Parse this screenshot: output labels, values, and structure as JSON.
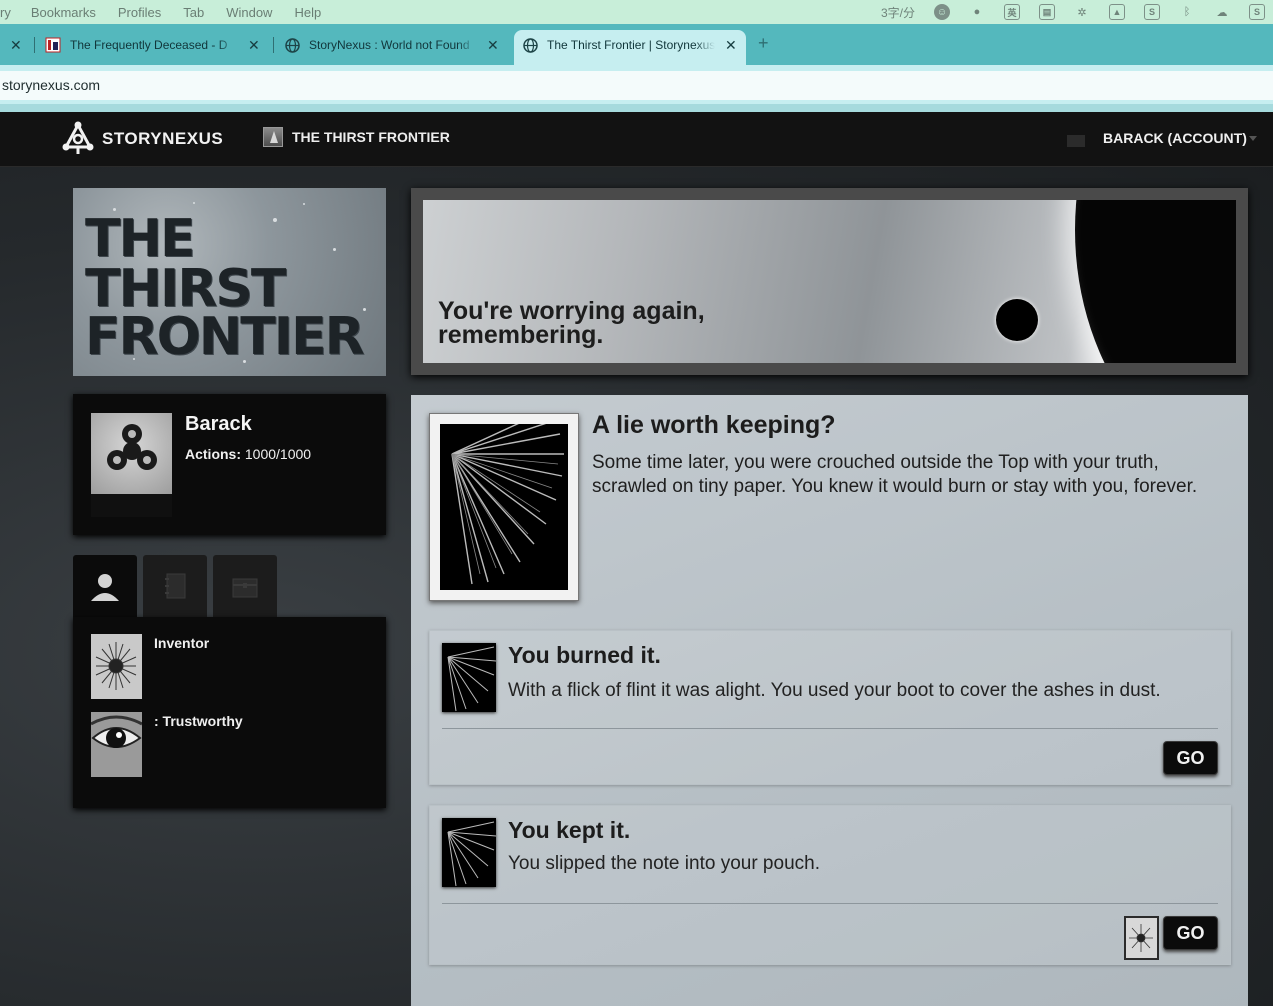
{
  "menubar": {
    "items": [
      "ry",
      "Bookmarks",
      "Profiles",
      "Tab",
      "Window",
      "Help"
    ],
    "input_rate": "3字/分",
    "ime_label": "英"
  },
  "browser": {
    "tabs": [
      {
        "title": "The Frequently Deceased - D",
        "active": false
      },
      {
        "title": "StoryNexus : World not Found",
        "active": false
      },
      {
        "title": "The Thirst Frontier | Storynexus",
        "active": true
      }
    ],
    "address": "storynexus.com",
    "new_tab": "+"
  },
  "site": {
    "brand": "STORYNEXUS",
    "game_title": "THE THIRST FRONTIER",
    "account": "BARACK (ACCOUNT)"
  },
  "banner": {
    "lines": [
      "THE",
      "THIRST",
      "FRONTIER"
    ]
  },
  "character": {
    "name": "Barack",
    "actions_label": "Actions:",
    "actions_value": "1000/1000"
  },
  "qualities": [
    {
      "name": "Inventor",
      "icon": "star-sigil-icon"
    },
    {
      "name": ": Trustworthy",
      "icon": "eye-icon"
    }
  ],
  "storylet_header": {
    "title": "You're worrying again, remembering."
  },
  "storylet": {
    "title": "A lie worth keeping?",
    "description": "Some time later, you were crouched outside the Top with your truth, scrawled on tiny paper. You knew it would burn or stay with you, forever."
  },
  "branches": [
    {
      "title": "You burned it.",
      "description": "With a flick of flint it was alight. You used your boot to cover the ashes in dust.",
      "button": "GO"
    },
    {
      "title": "You kept it.",
      "description": "You slipped the note into your pouch.",
      "button": "GO"
    }
  ]
}
